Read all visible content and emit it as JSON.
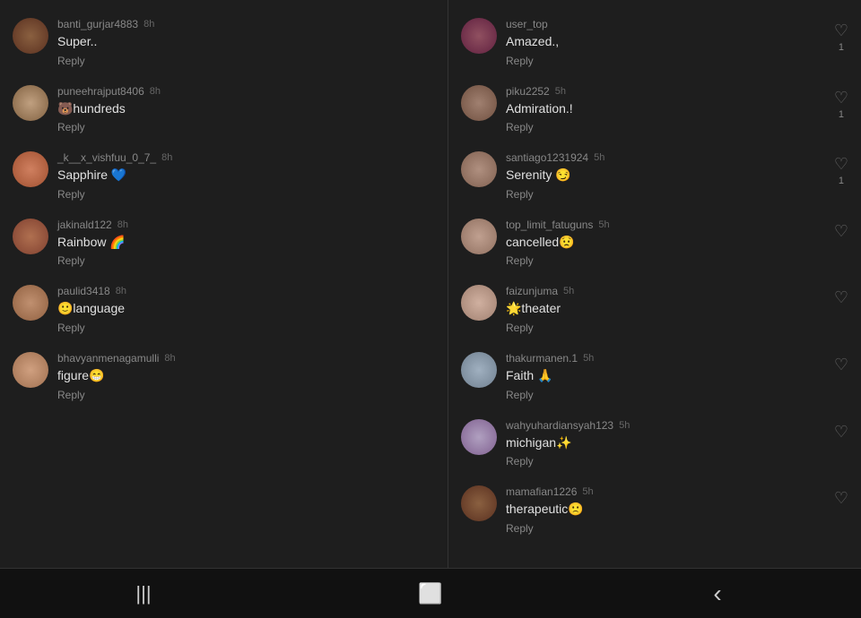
{
  "left_comments": [
    {
      "id": 1,
      "avatar_class": "av1",
      "username": "banti_gurjar4883",
      "time": "8h",
      "text": "Super..",
      "reply": "Reply"
    },
    {
      "id": 2,
      "avatar_class": "av2",
      "username": "puneehrajput8406",
      "time": "8h",
      "text": "🐻hundreds",
      "reply": "Reply"
    },
    {
      "id": 3,
      "avatar_class": "av3",
      "username": "_k__x_vishfuu_0_7_",
      "time": "8h",
      "text": "Sapphire 💙",
      "reply": "Reply"
    },
    {
      "id": 4,
      "avatar_class": "av4",
      "username": "jakinald122",
      "time": "8h",
      "text": "Rainbow 🌈",
      "reply": "Reply"
    },
    {
      "id": 5,
      "avatar_class": "av5",
      "username": "paulid3418",
      "time": "8h",
      "text": "🙂language",
      "reply": "Reply"
    },
    {
      "id": 6,
      "avatar_class": "av6",
      "username": "bhavyanmenagamulli",
      "time": "8h",
      "text": "figure😁",
      "reply": "Reply"
    }
  ],
  "right_comments": [
    {
      "id": 1,
      "avatar_class": "av7",
      "username": "user_top",
      "time": "",
      "text": "Amazed.,",
      "reply": "Reply",
      "likes": 1
    },
    {
      "id": 2,
      "avatar_class": "av8",
      "username": "piku2252",
      "time": "5h",
      "text": "Admiration.!",
      "reply": "Reply",
      "likes": 1
    },
    {
      "id": 3,
      "avatar_class": "av9",
      "username": "santiago1231924",
      "time": "5h",
      "text": "Serenity 😏",
      "reply": "Reply",
      "likes": 1
    },
    {
      "id": 4,
      "avatar_class": "av10",
      "username": "top_limit_fatuguns",
      "time": "5h",
      "text": "cancelled😟",
      "reply": "Reply",
      "likes": 0
    },
    {
      "id": 5,
      "avatar_class": "av11",
      "username": "faizunjuma",
      "time": "5h",
      "text": "🌟theater",
      "reply": "Reply",
      "likes": 0
    },
    {
      "id": 6,
      "avatar_class": "av12",
      "username": "thakurmanen.1",
      "time": "5h",
      "text": "Faith 🙏",
      "reply": "Reply",
      "likes": 0
    },
    {
      "id": 7,
      "avatar_class": "av13",
      "username": "wahyuhardiansyah123",
      "time": "5h",
      "text": "michigan✨",
      "reply": "Reply",
      "likes": 0
    },
    {
      "id": 8,
      "avatar_class": "av1",
      "username": "mamafian1226",
      "time": "5h",
      "text": "therapeutic🙁",
      "reply": "Reply",
      "likes": 0
    }
  ],
  "nav": {
    "menu_icon": "|||",
    "home_icon": "⬜",
    "back_icon": "‹"
  }
}
